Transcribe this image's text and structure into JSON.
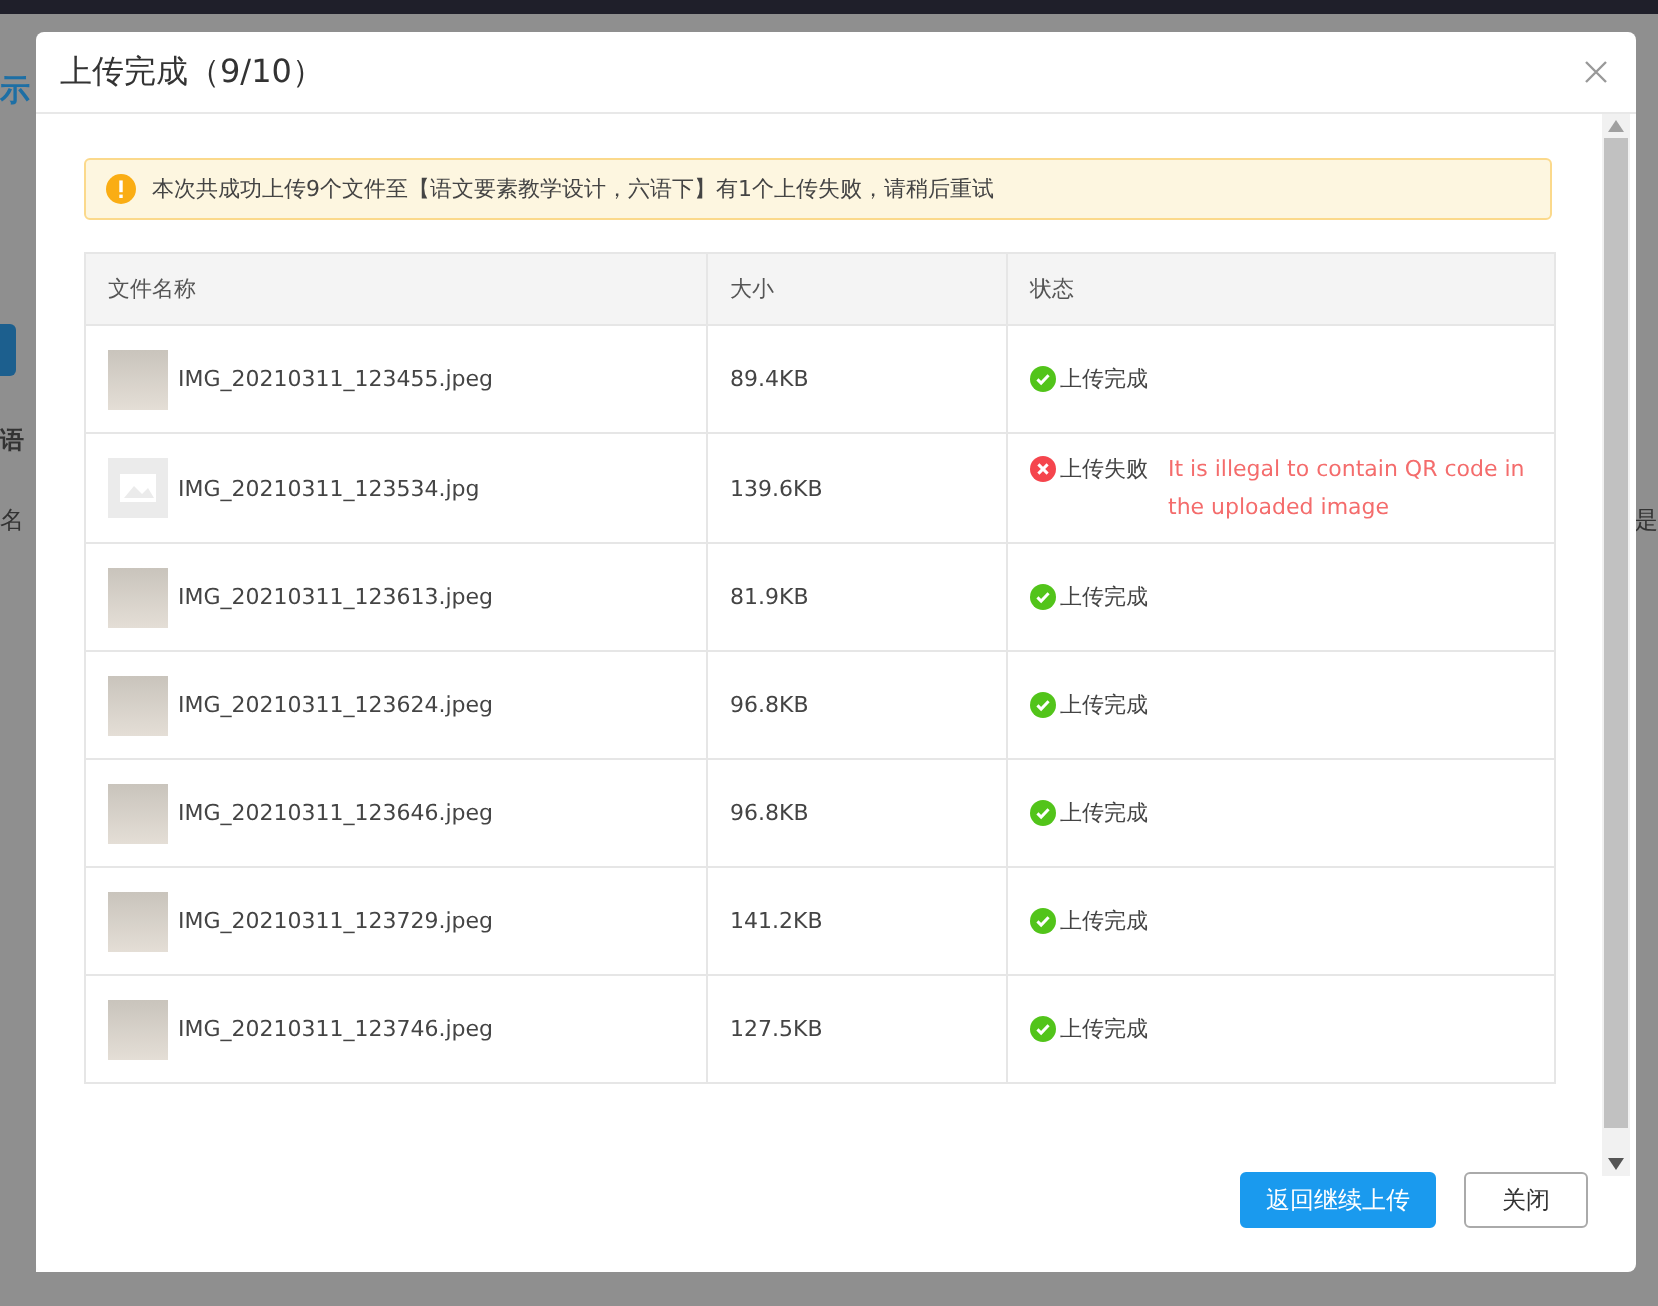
{
  "backdrop": {
    "texts": [
      "示",
      "语",
      "名",
      "是"
    ]
  },
  "dialog": {
    "title": "上传完成（9/10）",
    "alert": {
      "text": "本次共成功上传9个文件至【语文要素教学设计，六语下】有1个上传失败，请稍后重试"
    },
    "table": {
      "columns": [
        "文件名称",
        "大小",
        "状态"
      ],
      "rows": [
        {
          "thumbnail": {
            "kind": "photo"
          },
          "name": "IMG_20210311_123455.jpeg",
          "size": "89.4KB",
          "status": {
            "kind": "success",
            "label": "上传完成"
          }
        },
        {
          "thumbnail": {
            "kind": "missing"
          },
          "name": "IMG_20210311_123534.jpg",
          "size": "139.6KB",
          "status": {
            "kind": "failed",
            "label": "上传失败",
            "message": "It is illegal to contain QR code in the uploaded image"
          }
        },
        {
          "thumbnail": {
            "kind": "photo"
          },
          "name": "IMG_20210311_123613.jpeg",
          "size": "81.9KB",
          "status": {
            "kind": "success",
            "label": "上传完成"
          }
        },
        {
          "thumbnail": {
            "kind": "photo"
          },
          "name": "IMG_20210311_123624.jpeg",
          "size": "96.8KB",
          "status": {
            "kind": "success",
            "label": "上传完成"
          }
        },
        {
          "thumbnail": {
            "kind": "photo"
          },
          "name": "IMG_20210311_123646.jpeg",
          "size": "96.8KB",
          "status": {
            "kind": "success",
            "label": "上传完成"
          }
        },
        {
          "thumbnail": {
            "kind": "photo"
          },
          "name": "IMG_20210311_123729.jpeg",
          "size": "141.2KB",
          "status": {
            "kind": "success",
            "label": "上传完成"
          }
        },
        {
          "thumbnail": {
            "kind": "photo"
          },
          "name": "IMG_20210311_123746.jpeg",
          "size": "127.5KB",
          "status": {
            "kind": "success",
            "label": "上传完成"
          }
        }
      ]
    },
    "buttons": [
      {
        "kind": "primary",
        "label": "返回继续上传"
      },
      {
        "kind": "default",
        "label": "关闭"
      }
    ]
  }
}
